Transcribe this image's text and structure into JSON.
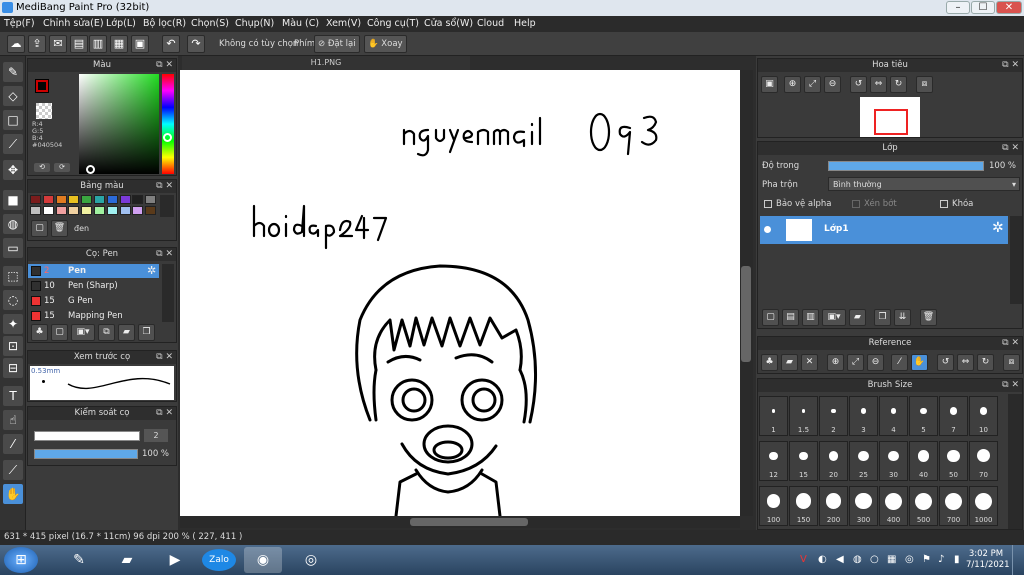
{
  "window": {
    "title": "MediBang Paint Pro (32bit)",
    "min": "–",
    "max": "☐",
    "close": "✕"
  },
  "menu": [
    "Tệp(F)",
    "Chỉnh sửa(E)",
    "Lớp(L)",
    "Bộ lọc(R)",
    "Chọn(S)",
    "Chụp(N)",
    "Màu (C)",
    "Xem(V)",
    "Công cụ(T)",
    "Cửa sổ(W)",
    "Cloud",
    "Help"
  ],
  "toolbar": {
    "no_options": "Không có tùy chọn",
    "key_label": "Phím",
    "reset": "Đặt lại",
    "rotate": "Xoay"
  },
  "color_panel": {
    "title": "Màu",
    "r": "R:4",
    "g": "G:5",
    "b": "B:4",
    "hex": "#040504",
    "fg": "#040504",
    "bg": "#ffffff"
  },
  "palette_panel": {
    "title": "Bảng màu",
    "name": "đen",
    "colors": [
      "#7a1c1c",
      "#d43b3b",
      "#e07b20",
      "#e8c020",
      "#3aa640",
      "#2aa6a6",
      "#2b6ad9",
      "#7b3ad9",
      "#202020",
      "#808080",
      "#c0c0c0",
      "#ffffff",
      "#f0a0a0",
      "#f0d0a0",
      "#f0f0a0",
      "#a0f0a0",
      "#a0f0f0",
      "#a0c0f0",
      "#d0a0f0",
      "#5a3a1a"
    ]
  },
  "brush_panel": {
    "title": "Cọ: Pen",
    "brushes": [
      {
        "size": "2",
        "name": "Pen",
        "color": "#303030"
      },
      {
        "size": "10",
        "name": "Pen (Sharp)",
        "color": "#303030"
      },
      {
        "size": "15",
        "name": "G Pen",
        "color": "#e33"
      },
      {
        "size": "15",
        "name": "Mapping Pen",
        "color": "#e33"
      }
    ]
  },
  "preview_panel": {
    "title": "Xem trước cọ",
    "size": "0.53mm"
  },
  "control_panel": {
    "title": "Kiểm soát cọ",
    "size": "2",
    "opacity": "100 %",
    "opacity_value": 1.0
  },
  "canvas": {
    "tab": "H1.PNG"
  },
  "navigator_panel": {
    "title": "Hoa tiêu"
  },
  "layer_panel": {
    "title": "Lớp",
    "opacity_label": "Độ trong",
    "opacity": "100 %",
    "opacity_value": 1.0,
    "blend_label": "Pha trộn",
    "blend": "Bình thường",
    "protect_alpha": "Bảo vệ alpha",
    "clip": "Xén bớt",
    "lock": "Khóa",
    "layer_name": "Lớp1"
  },
  "reference_panel": {
    "title": "Reference"
  },
  "brushsize_panel": {
    "title": "Brush Size",
    "sizes": [
      "1",
      "1.5",
      "2",
      "3",
      "4",
      "5",
      "7",
      "10",
      "12",
      "15",
      "20",
      "25",
      "30",
      "40",
      "50",
      "70",
      "100",
      "150",
      "200",
      "300",
      "400",
      "500",
      "700",
      "1000"
    ]
  },
  "status": {
    "text": "631 * 415 pixel  (16.7 * 11cm)  96 dpi  200 %  ( 227, 411 )"
  },
  "taskbar": {
    "time": "3:02 PM",
    "date": "7/11/2021",
    "zalo": "Zalo"
  }
}
